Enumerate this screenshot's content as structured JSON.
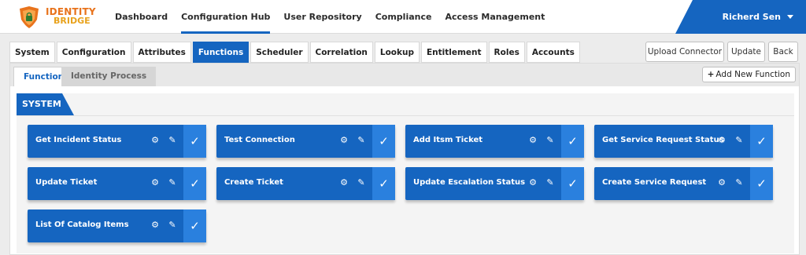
{
  "brand": {
    "line1": "IDENTITY",
    "line2": "BRIDGE"
  },
  "nav": {
    "items": [
      {
        "label": "Dashboard"
      },
      {
        "label": "Configuration Hub"
      },
      {
        "label": "User Repository"
      },
      {
        "label": "Compliance"
      },
      {
        "label": "Access Management"
      }
    ],
    "active": "Configuration Hub"
  },
  "user": {
    "name": "Richerd Sen"
  },
  "tabs": {
    "items": [
      {
        "label": "System"
      },
      {
        "label": "Configuration"
      },
      {
        "label": "Attributes"
      },
      {
        "label": "Functions"
      },
      {
        "label": "Scheduler"
      },
      {
        "label": "Correlation"
      },
      {
        "label": "Lookup"
      },
      {
        "label": "Entitlement"
      },
      {
        "label": "Roles"
      },
      {
        "label": "Accounts"
      }
    ],
    "active": "Functions"
  },
  "actions": {
    "upload": "Upload Connector",
    "update": "Update",
    "back": "Back"
  },
  "subtabs": {
    "function": "Function",
    "identity_process": "Identity Process",
    "active": "Function"
  },
  "add_function": {
    "plus": "+",
    "label": "Add New Function"
  },
  "section": {
    "title": "SYSTEM"
  },
  "icons": {
    "gear": "gear-icon",
    "edit": "pencil-icon",
    "check": "check-icon"
  },
  "colors": {
    "primary": "#1565c0",
    "accent": "#2a80de",
    "logo_orange": "#e8731c"
  },
  "functions": [
    {
      "label": "Get Incident Status"
    },
    {
      "label": "Test Connection"
    },
    {
      "label": "Add Itsm Ticket"
    },
    {
      "label": "Get Service Request Status"
    },
    {
      "label": "Update Ticket"
    },
    {
      "label": "Create Ticket"
    },
    {
      "label": "Update Escalation Status"
    },
    {
      "label": "Create Service Request"
    },
    {
      "label": "List Of Catalog Items"
    }
  ]
}
